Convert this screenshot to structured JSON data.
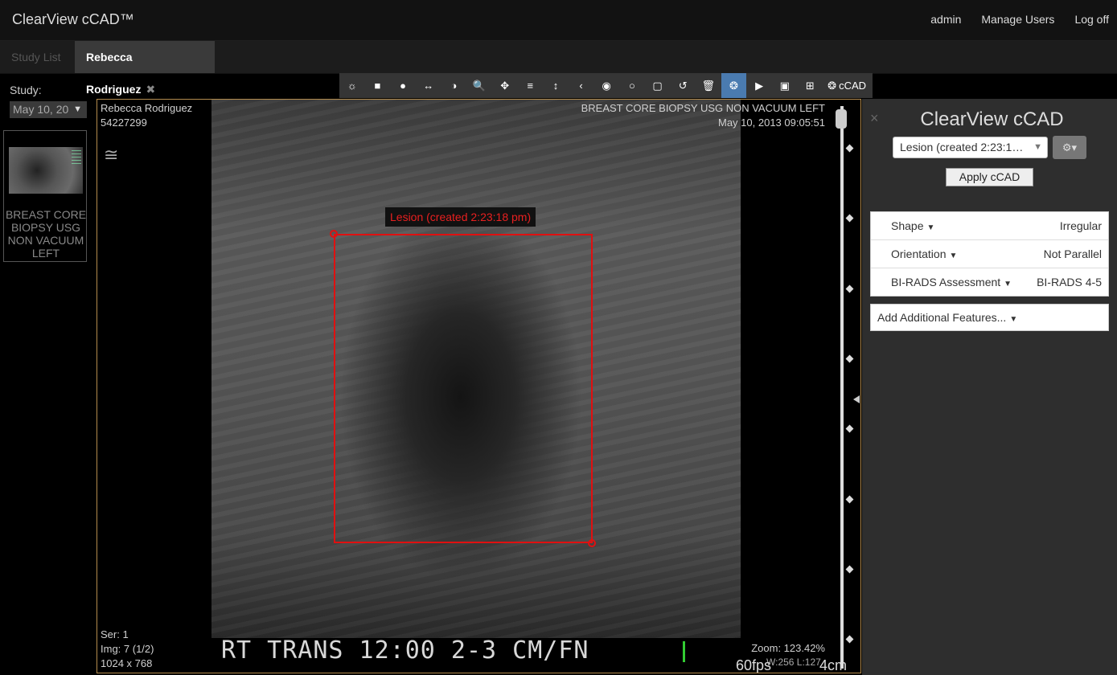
{
  "header": {
    "brand": "ClearView cCAD™",
    "nav": {
      "admin": "admin",
      "manage_users": "Manage Users",
      "log_off": "Log off"
    }
  },
  "tabs": {
    "study_list": "Study List",
    "patient": "Rebecca Rodriguez",
    "close": "✖"
  },
  "sidebar": {
    "study_label": "Study:",
    "study_date": "May 10, 20",
    "thumbnail_caption": "BREAST CORE BIOPSY USG NON VACUUM LEFT"
  },
  "toolbar": {
    "tools": [
      {
        "name": "brightness-icon",
        "glyph": "☼"
      },
      {
        "name": "square-roi-icon",
        "glyph": "■"
      },
      {
        "name": "ellipse-roi-icon",
        "glyph": "●"
      },
      {
        "name": "length-icon",
        "glyph": "↔"
      },
      {
        "name": "contrast-icon",
        "glyph": "◑"
      },
      {
        "name": "zoom-icon",
        "glyph": "🔍"
      },
      {
        "name": "pan-icon",
        "glyph": "✥"
      },
      {
        "name": "stack-scroll-icon",
        "glyph": "≡"
      },
      {
        "name": "vertical-arrows-icon",
        "glyph": "↕"
      },
      {
        "name": "previous-icon",
        "glyph": "‹"
      },
      {
        "name": "target-icon",
        "glyph": "◉"
      },
      {
        "name": "circle-icon",
        "glyph": "○"
      },
      {
        "name": "square-outline-icon",
        "glyph": "▢"
      },
      {
        "name": "reset-icon",
        "glyph": "↺"
      },
      {
        "name": "trash-icon",
        "glyph": "🗑"
      },
      {
        "name": "cad-tool-icon",
        "glyph": "❂",
        "active": true
      },
      {
        "name": "play-icon",
        "glyph": "▶"
      },
      {
        "name": "cine-icon",
        "glyph": "▣"
      },
      {
        "name": "layout-icon",
        "glyph": "⊞"
      }
    ],
    "ccad_label": "cCAD",
    "active_color": "#4a7bb0"
  },
  "viewport": {
    "patient_name": "Rebecca Rodriguez",
    "patient_id": "54227299",
    "study_desc": "BREAST CORE BIOPSY USG NON VACUUM LEFT",
    "study_datetime": "May 10, 2013 09:05:51",
    "series": "Ser: 1",
    "image": "Img: 7 (1/2)",
    "dimensions": "1024 x 768",
    "zoom": "Zoom: 123.42%",
    "window_level": "W:256 L:127",
    "burned_text": "RT TRANS 12:00 2-3 CM/FN",
    "fps": "60fps",
    "depth": "4cm",
    "annotation_label": "Lesion (created 2:23:18 pm)",
    "annotation_color": "#e01010",
    "frame_color": "#b38b4d"
  },
  "panel": {
    "close": "×",
    "title": "ClearView cCAD",
    "lesion_selected": "Lesion (created 2:23:1…",
    "gear": "⚙▾",
    "apply_label": "Apply cCAD",
    "features": [
      {
        "name": "Shape",
        "value": "Irregular"
      },
      {
        "name": "Orientation",
        "value": "Not Parallel"
      },
      {
        "name": "BI-RADS Assessment",
        "value": "BI-RADS 4-5"
      }
    ],
    "add_features": "Add Additional Features..."
  }
}
